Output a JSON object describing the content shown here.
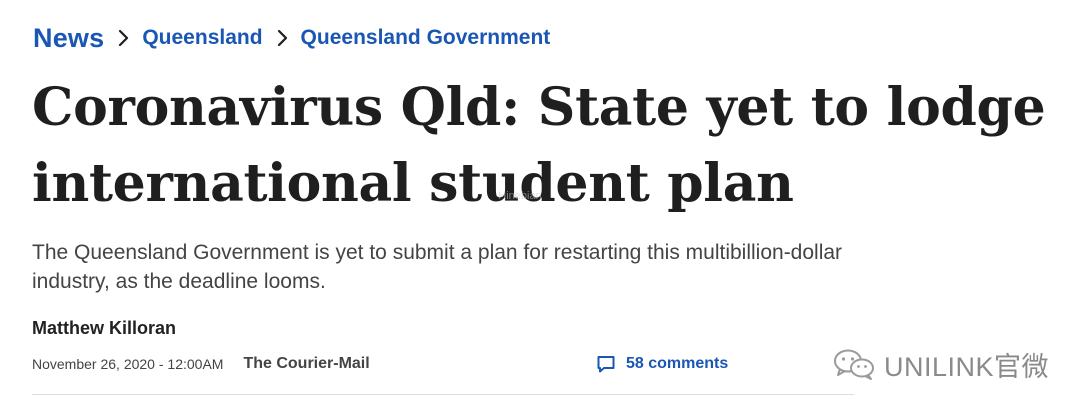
{
  "breadcrumb": {
    "items": [
      {
        "label": "News"
      },
      {
        "label": "Queensland"
      },
      {
        "label": "Queensland Government"
      }
    ]
  },
  "article": {
    "headline": "Coronavirus Qld: State yet to lodge international student plan",
    "standfirst": "The Queensland Government is yet to submit a plan for restarting this multibillion-dollar industry, as the deadline looms.",
    "author": "Matthew Killoran",
    "date": "November 26, 2020 - 12:00AM",
    "source": "The Courier-Mail",
    "comments_label": "58 comments"
  },
  "watermarks": {
    "center_line1": "",
    "center_line2": "Hinebian",
    "wechat_text": "UNILINK官微"
  },
  "icons": {
    "breadcrumb_separator": "chevron-right-icon",
    "comments": "speech-bubble-icon",
    "wechat": "wechat-logo-icon"
  },
  "colors": {
    "link_blue": "#1a56b4",
    "headline": "#1f1f1f",
    "body_text": "#444444",
    "watermark_gray": "#8a8a8a"
  }
}
